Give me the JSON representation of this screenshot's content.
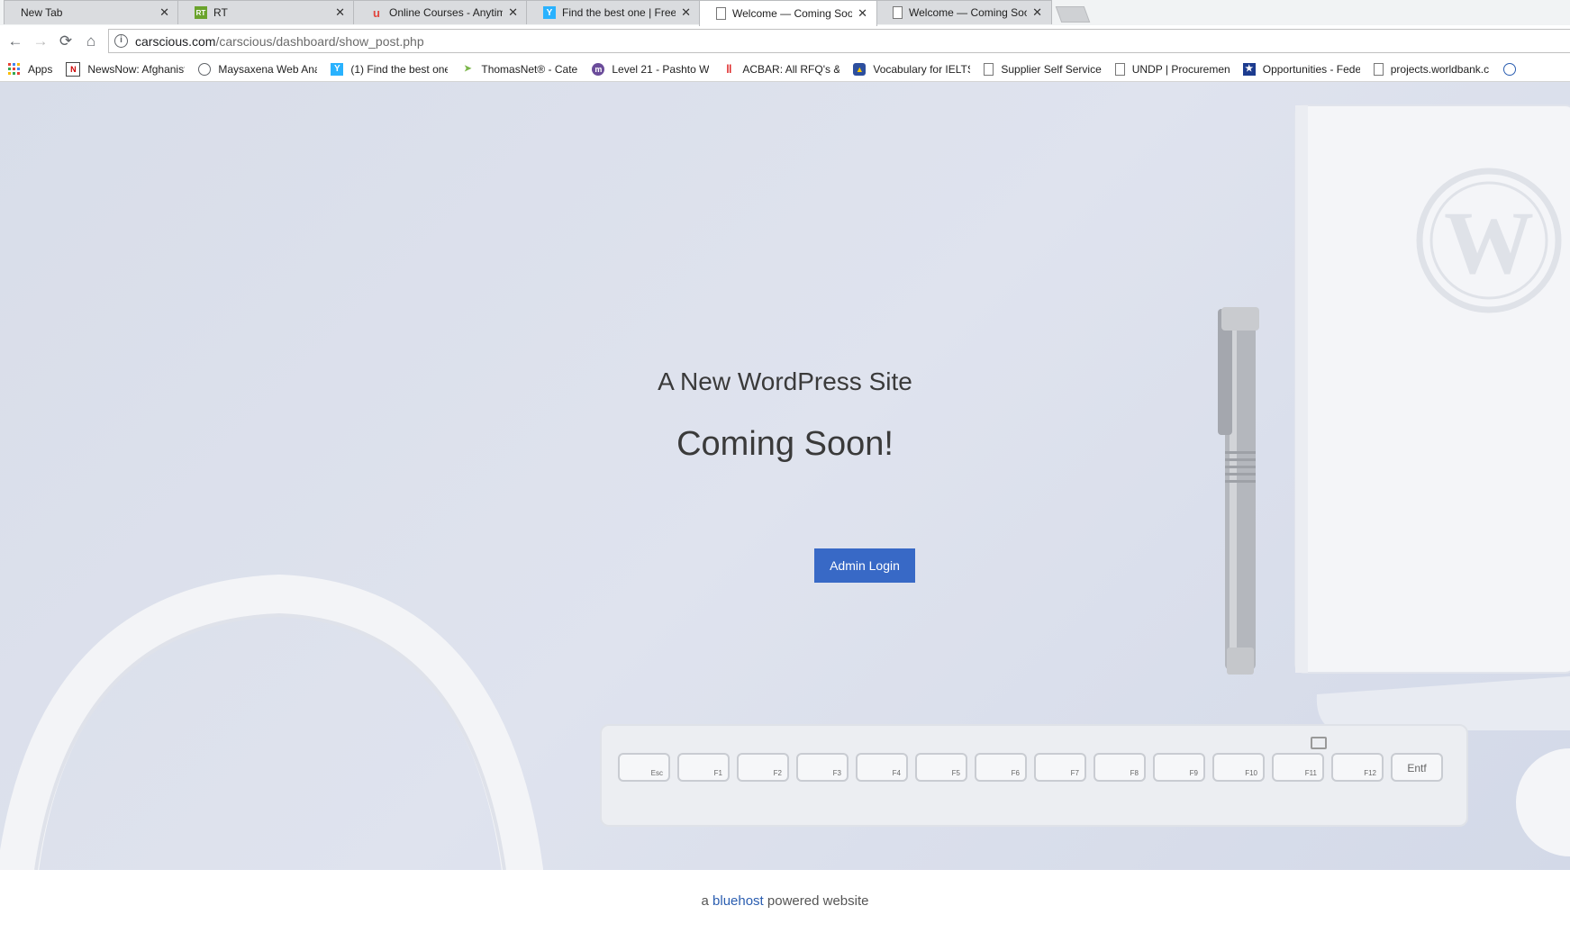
{
  "browser": {
    "tabs": [
      {
        "label": "New Tab",
        "favicon": "blank"
      },
      {
        "label": "RT",
        "favicon": "rt-icon"
      },
      {
        "label": "Online Courses - Anytime",
        "favicon": "udemy-icon"
      },
      {
        "label": "Find the best one | Freela",
        "favicon": "freelancer-icon"
      },
      {
        "label": "Welcome — Coming Soo",
        "favicon": "page-icon"
      },
      {
        "label": "Welcome — Coming Soo",
        "favicon": "page-icon"
      }
    ],
    "active_tab_index": 4,
    "url_host": "carscious.com",
    "url_path": "/carscious/dashboard/show_post.php",
    "bookmarks": [
      {
        "label": "Apps",
        "icon": "apps-grid-icon"
      },
      {
        "label": "NewsNow: Afghanist",
        "icon": "newsnow-icon"
      },
      {
        "label": "Maysaxena Web Ana",
        "icon": "globe-icon"
      },
      {
        "label": "(1) Find the best one",
        "icon": "freelancer-icon"
      },
      {
        "label": "ThomasNet® - Cate",
        "icon": "thomasnet-icon"
      },
      {
        "label": "Level 21 - Pashto W",
        "icon": "memrise-icon"
      },
      {
        "label": "ACBAR: All RFQ's &",
        "icon": "acbar-icon"
      },
      {
        "label": "Vocabulary for IELTS",
        "icon": "ielts-icon"
      },
      {
        "label": "Supplier Self Service",
        "icon": "page-icon"
      },
      {
        "label": "UNDP | Procuremen",
        "icon": "page-icon"
      },
      {
        "label": "Opportunities - Fede",
        "icon": "star-icon"
      },
      {
        "label": "projects.worldbank.c",
        "icon": "page-icon"
      }
    ]
  },
  "page": {
    "site_title": "A New WordPress Site",
    "headline": "Coming Soon!",
    "admin_button": "Admin Login",
    "footer_prefix": "a",
    "footer_link": "bluehost",
    "footer_suffix": "powered website",
    "keyboard_keys": [
      "Esc",
      "F1",
      "F2",
      "F3",
      "F4",
      "F5",
      "F6",
      "F7",
      "F8",
      "F9",
      "F10",
      "F11",
      "F12",
      "Entf"
    ]
  },
  "colors": {
    "accent": "#3869c6",
    "hero_bg": "#dbe0eb"
  }
}
